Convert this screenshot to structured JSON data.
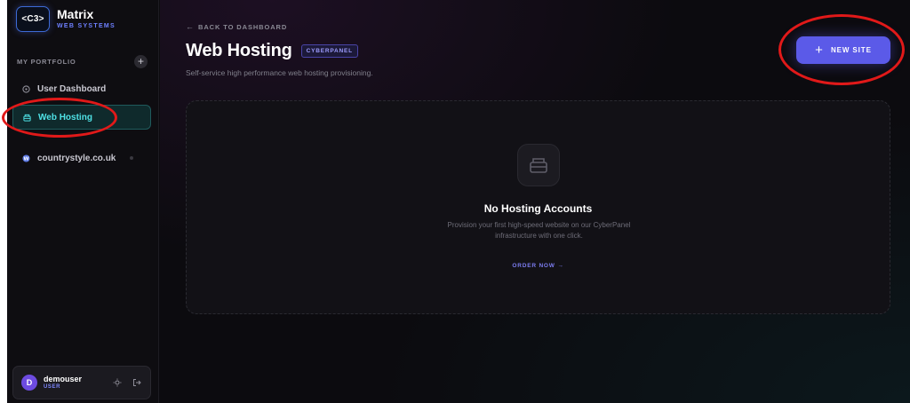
{
  "brand": {
    "logo_text": "<C3>",
    "title": "Matrix",
    "subtitle": "WEB SYSTEMS"
  },
  "sidebar": {
    "section_label": "MY PORTFOLIO",
    "add_symbol": "+",
    "items": [
      {
        "label": "User Dashboard",
        "icon": "gauge-icon",
        "active": false
      },
      {
        "label": "Web Hosting",
        "icon": "server-icon",
        "active": true
      },
      {
        "label": "countrystyle.co.uk",
        "icon": "wordpress-icon",
        "active": false
      }
    ]
  },
  "user": {
    "initial": "D",
    "name": "demouser",
    "role": "USER"
  },
  "header": {
    "back_label": "BACK TO DASHBOARD",
    "title": "Web Hosting",
    "badge": "CYBERPANEL",
    "subtitle": "Self-service high performance web hosting provisioning."
  },
  "actions": {
    "new_site_label": "NEW SITE",
    "new_site_symbol": "+"
  },
  "empty_state": {
    "title": "No Hosting Accounts",
    "description": "Provision your first high-speed website on our CyberPanel infrastructure with one click.",
    "cta_label": "ORDER NOW →"
  },
  "colors": {
    "accent": "#5b5ae8",
    "active_nav": "#4fe2e6",
    "annotation": "#e11919"
  }
}
